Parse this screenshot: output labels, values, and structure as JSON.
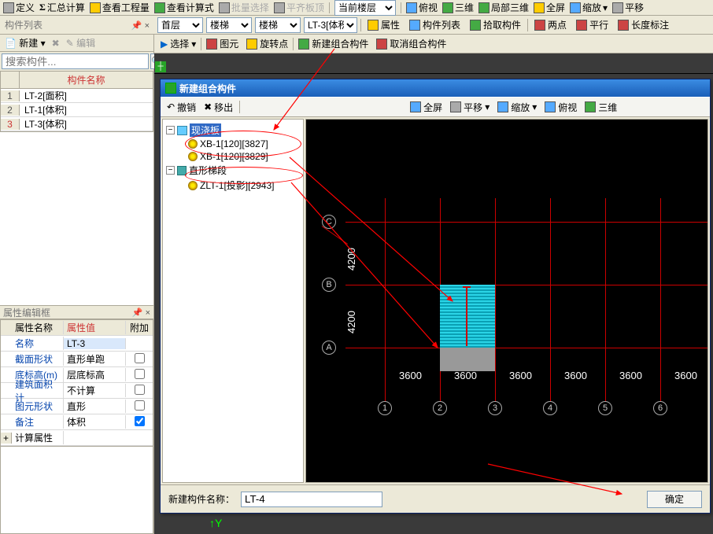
{
  "toolbar_top": {
    "items": [
      "定义",
      "汇总计算",
      "查看工程量",
      "查看计算式",
      "批量选择",
      "平齐板顶"
    ],
    "floor_combo": "当前楼层",
    "view_items": [
      "俯视",
      "三维",
      "局部三维",
      "全屏",
      "缩放",
      "平移"
    ]
  },
  "toolbar_row2": {
    "left_title": "构件列表",
    "combos": [
      "首层",
      "楼梯",
      "楼梯",
      "LT-3[体积"
    ],
    "buttons": [
      "属性",
      "构件列表",
      "拾取构件",
      "两点",
      "平行",
      "长度标注"
    ]
  },
  "toolbar_row3": {
    "buttons": [
      "选择",
      "图元",
      "旋转点",
      "新建组合构件",
      "取消组合构件"
    ]
  },
  "sidebar": {
    "new_btn": "新建",
    "edit_btn": "编辑",
    "search_placeholder": "搜索构件...",
    "header": "构件名称",
    "rows": [
      {
        "n": "1",
        "name": "LT-2[面积]"
      },
      {
        "n": "2",
        "name": "LT-1[体积]"
      },
      {
        "n": "3",
        "name": "LT-3[体积]"
      }
    ],
    "prop_title": "属性编辑框",
    "prop_headers": {
      "c1": "属性名称",
      "c2": "属性值",
      "c3": "附加"
    },
    "prop_rows": [
      {
        "name": "名称",
        "value": "LT-3",
        "chk": false,
        "link": true,
        "hl": true
      },
      {
        "name": "截面形状",
        "value": "直形单跑",
        "chk": false,
        "link": true
      },
      {
        "name": "底标高(m)",
        "value": "层底标高",
        "chk": false,
        "link": true
      },
      {
        "name": "建筑面积计",
        "value": "不计算",
        "chk": false,
        "link": true
      },
      {
        "name": "图元形状",
        "value": "直形",
        "chk": false,
        "link": true
      },
      {
        "name": "备注",
        "value": "体积",
        "chk": true,
        "link": true
      },
      {
        "name": "计算属性",
        "value": "",
        "chk": null,
        "link": false,
        "expand": "+"
      }
    ]
  },
  "dialog": {
    "title": "新建组合构件",
    "toolbar": [
      "撤销",
      "移出",
      "全屏",
      "平移",
      "缩放",
      "俯视",
      "三维"
    ],
    "tree": {
      "n1": "现浇板",
      "n1_children": [
        "XB-1[120][3827]",
        "XB-1[120][3829]"
      ],
      "n2": "直形梯段",
      "n2_children": [
        "ZLT-1[投影][2943]"
      ]
    },
    "bottom_label": "新建构件名称：",
    "bottom_value": "LT-4",
    "ok_label": "确定"
  },
  "canvas": {
    "h_dims": [
      "3600",
      "3600",
      "3600",
      "3600",
      "3600",
      "3600"
    ],
    "v_dims": [
      "4200",
      "4200"
    ],
    "col_labels": [
      "1",
      "2",
      "3",
      "4",
      "5",
      "6"
    ],
    "row_labels": [
      "A",
      "B",
      "C"
    ]
  }
}
